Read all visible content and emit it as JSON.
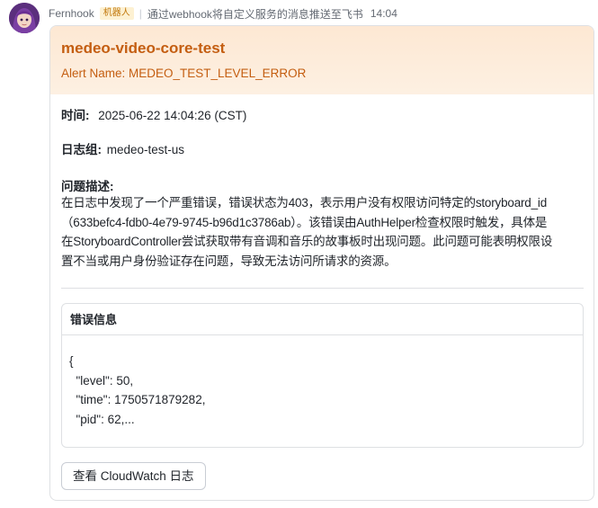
{
  "message": {
    "sender": "Fernhook",
    "bot_badge": "机器人",
    "separator": "|",
    "subtitle": "通过webhook将自定义服务的消息推送至飞书",
    "time": "14:04"
  },
  "card": {
    "title": "medeo-video-core-test",
    "alert_name": "Alert Name: MEDEO_TEST_LEVEL_ERROR",
    "time_label": "时间:",
    "time_value": "2025-06-22 14:04:26 (CST)",
    "group_label": "日志组:",
    "group_value": "medeo-test-us",
    "desc_label": "问题描述:",
    "desc_lines": [
      "在日志中发现了一个严重错误，错误状态为403，表示用户没有权限访问特定的storyboard_id",
      "（633befc4-fdb0-4e79-9745-b96d1c3786ab）。该错误由AuthHelper检查权限时触发，具体是",
      "在StoryboardController尝试获取带有音调和音乐的故事板时出现问题。此问题可能表明权限设",
      "置不当或用户身份验证存在问题，导致无法访问所请求的资源。"
    ],
    "error_panel_title": "错误信息",
    "error_code_lines": [
      "{",
      "  \"level\": 50,",
      "  \"time\": 1750571879282,",
      "  \"pid\": 62,..."
    ],
    "button_label": "查看 CloudWatch 日志"
  },
  "colors": {
    "title": "#c45e11",
    "header_bg": "#fde8d3",
    "badge_bg": "#fdf1d2",
    "badge_text": "#c1770a",
    "border": "#dee0e3"
  }
}
